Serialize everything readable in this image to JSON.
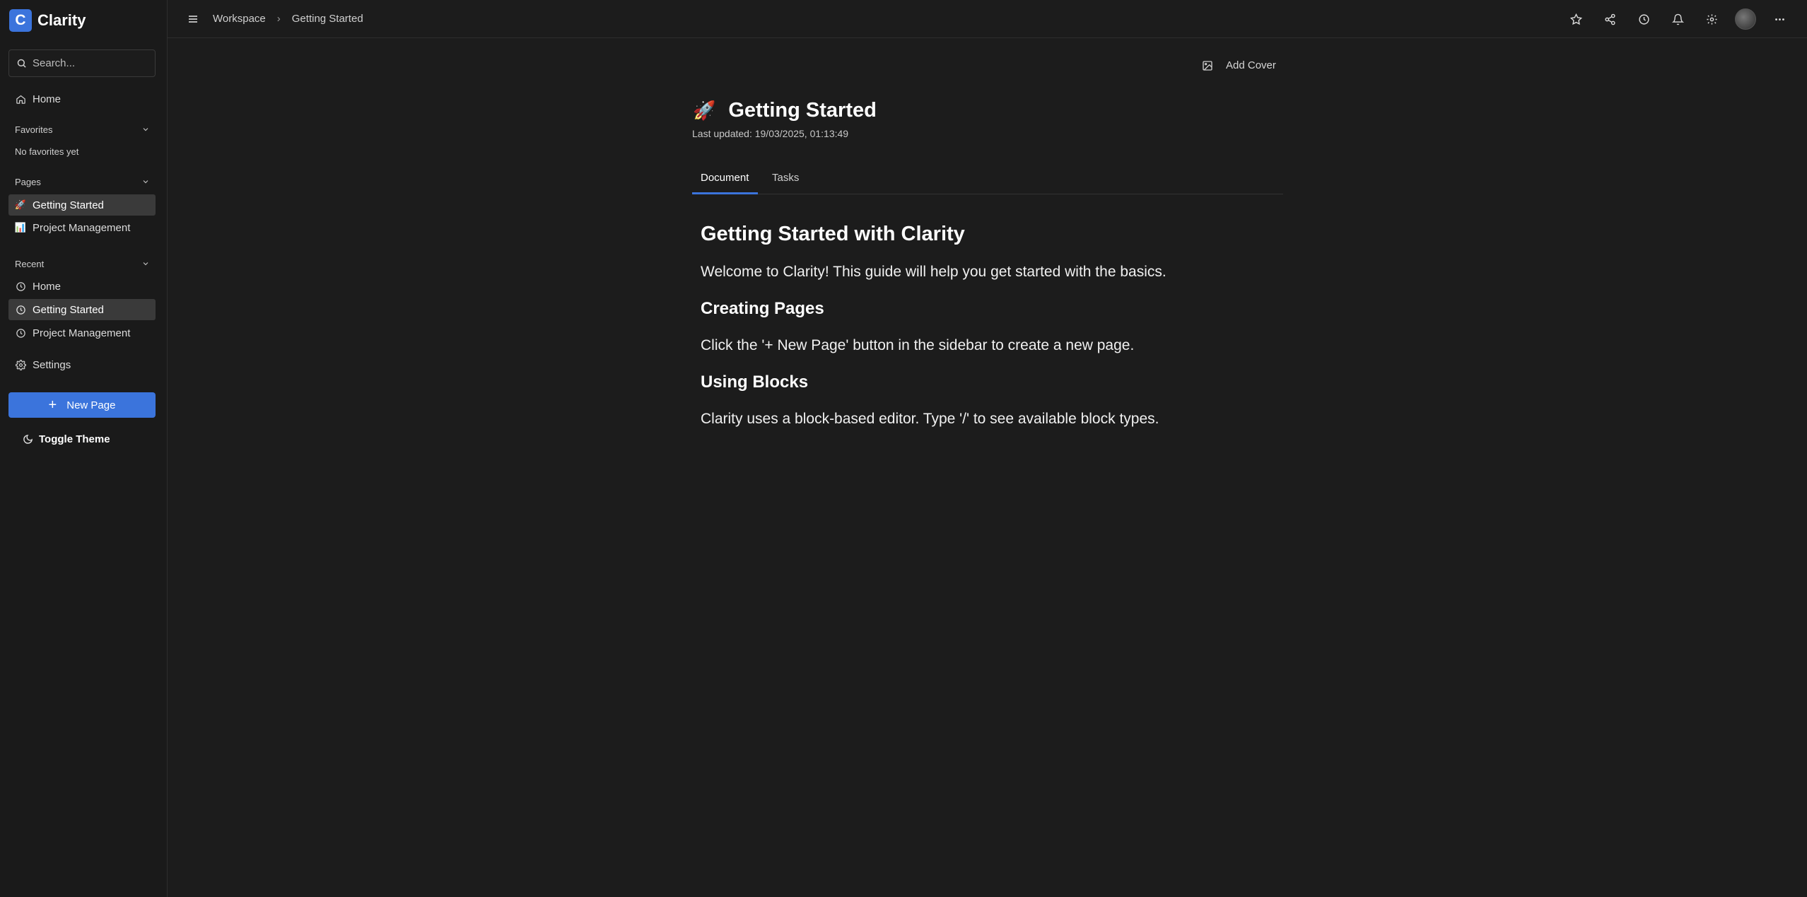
{
  "brand": {
    "logo_letter": "C",
    "name": "Clarity",
    "accent": "#3b74dc"
  },
  "sidebar": {
    "search_placeholder": "Search...",
    "home": "Home",
    "favorites": {
      "heading": "Favorites",
      "empty": "No favorites yet"
    },
    "pages": {
      "heading": "Pages",
      "items": [
        {
          "emoji": "🚀",
          "label": "Getting Started"
        },
        {
          "emoji": "📊",
          "label": "Project Management"
        }
      ]
    },
    "recent": {
      "heading": "Recent",
      "items": [
        {
          "label": "Home"
        },
        {
          "label": "Getting Started"
        },
        {
          "label": "Project Management"
        }
      ]
    },
    "settings": "Settings",
    "new_page": "New Page",
    "toggle_theme": "Toggle Theme"
  },
  "topbar": {
    "breadcrumb": [
      "Workspace",
      "Getting Started"
    ]
  },
  "page": {
    "add_cover": "Add Cover",
    "emoji": "🚀",
    "title": "Getting Started",
    "last_updated": "Last updated: 19/03/2025, 01:13:49",
    "tabs": [
      "Document",
      "Tasks"
    ],
    "content": {
      "h1": "Getting Started with Clarity",
      "p1": "Welcome to Clarity! This guide will help you get started with the basics.",
      "h2a": "Creating Pages",
      "p2": "Click the '+ New Page' button in the sidebar to create a new page.",
      "h2b": "Using Blocks",
      "p3": "Clarity uses a block-based editor. Type '/' to see available block types."
    }
  }
}
